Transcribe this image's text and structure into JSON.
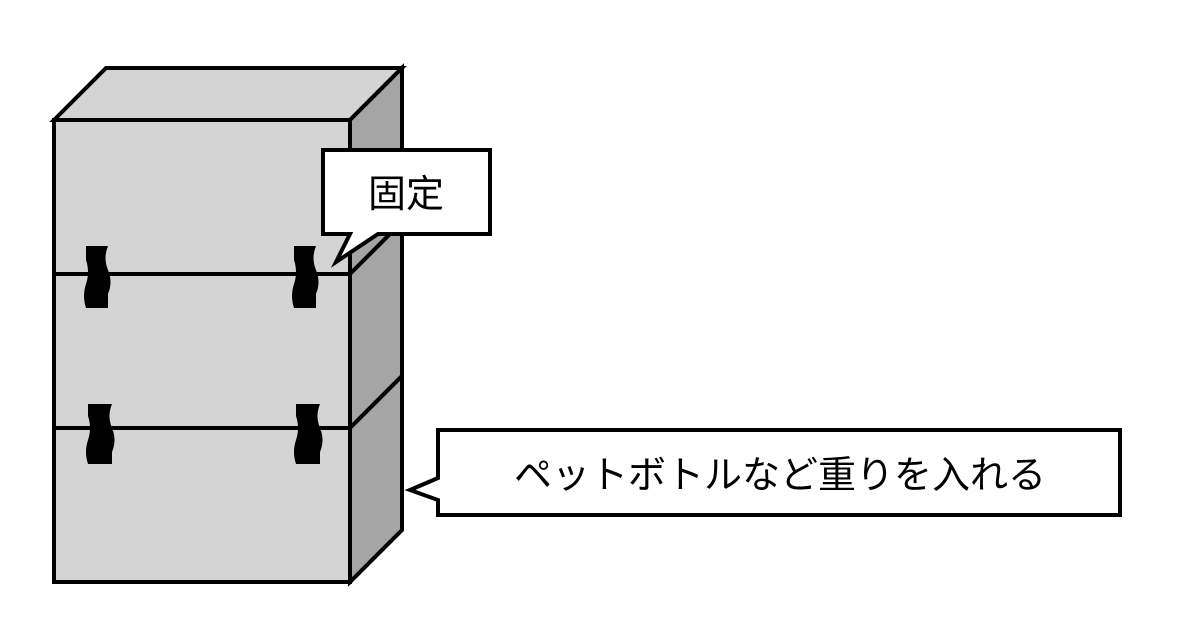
{
  "diagram": {
    "callouts": [
      {
        "text": "固定"
      },
      {
        "text": "ペットボトルなど重りを入れる"
      }
    ]
  },
  "colors": {
    "box_front": "#d4d4d4",
    "box_top": "#d4d4d4",
    "box_side": "#a5a5a5",
    "tape": "#000000",
    "outline": "#000000",
    "callout_fill": "#ffffff"
  }
}
